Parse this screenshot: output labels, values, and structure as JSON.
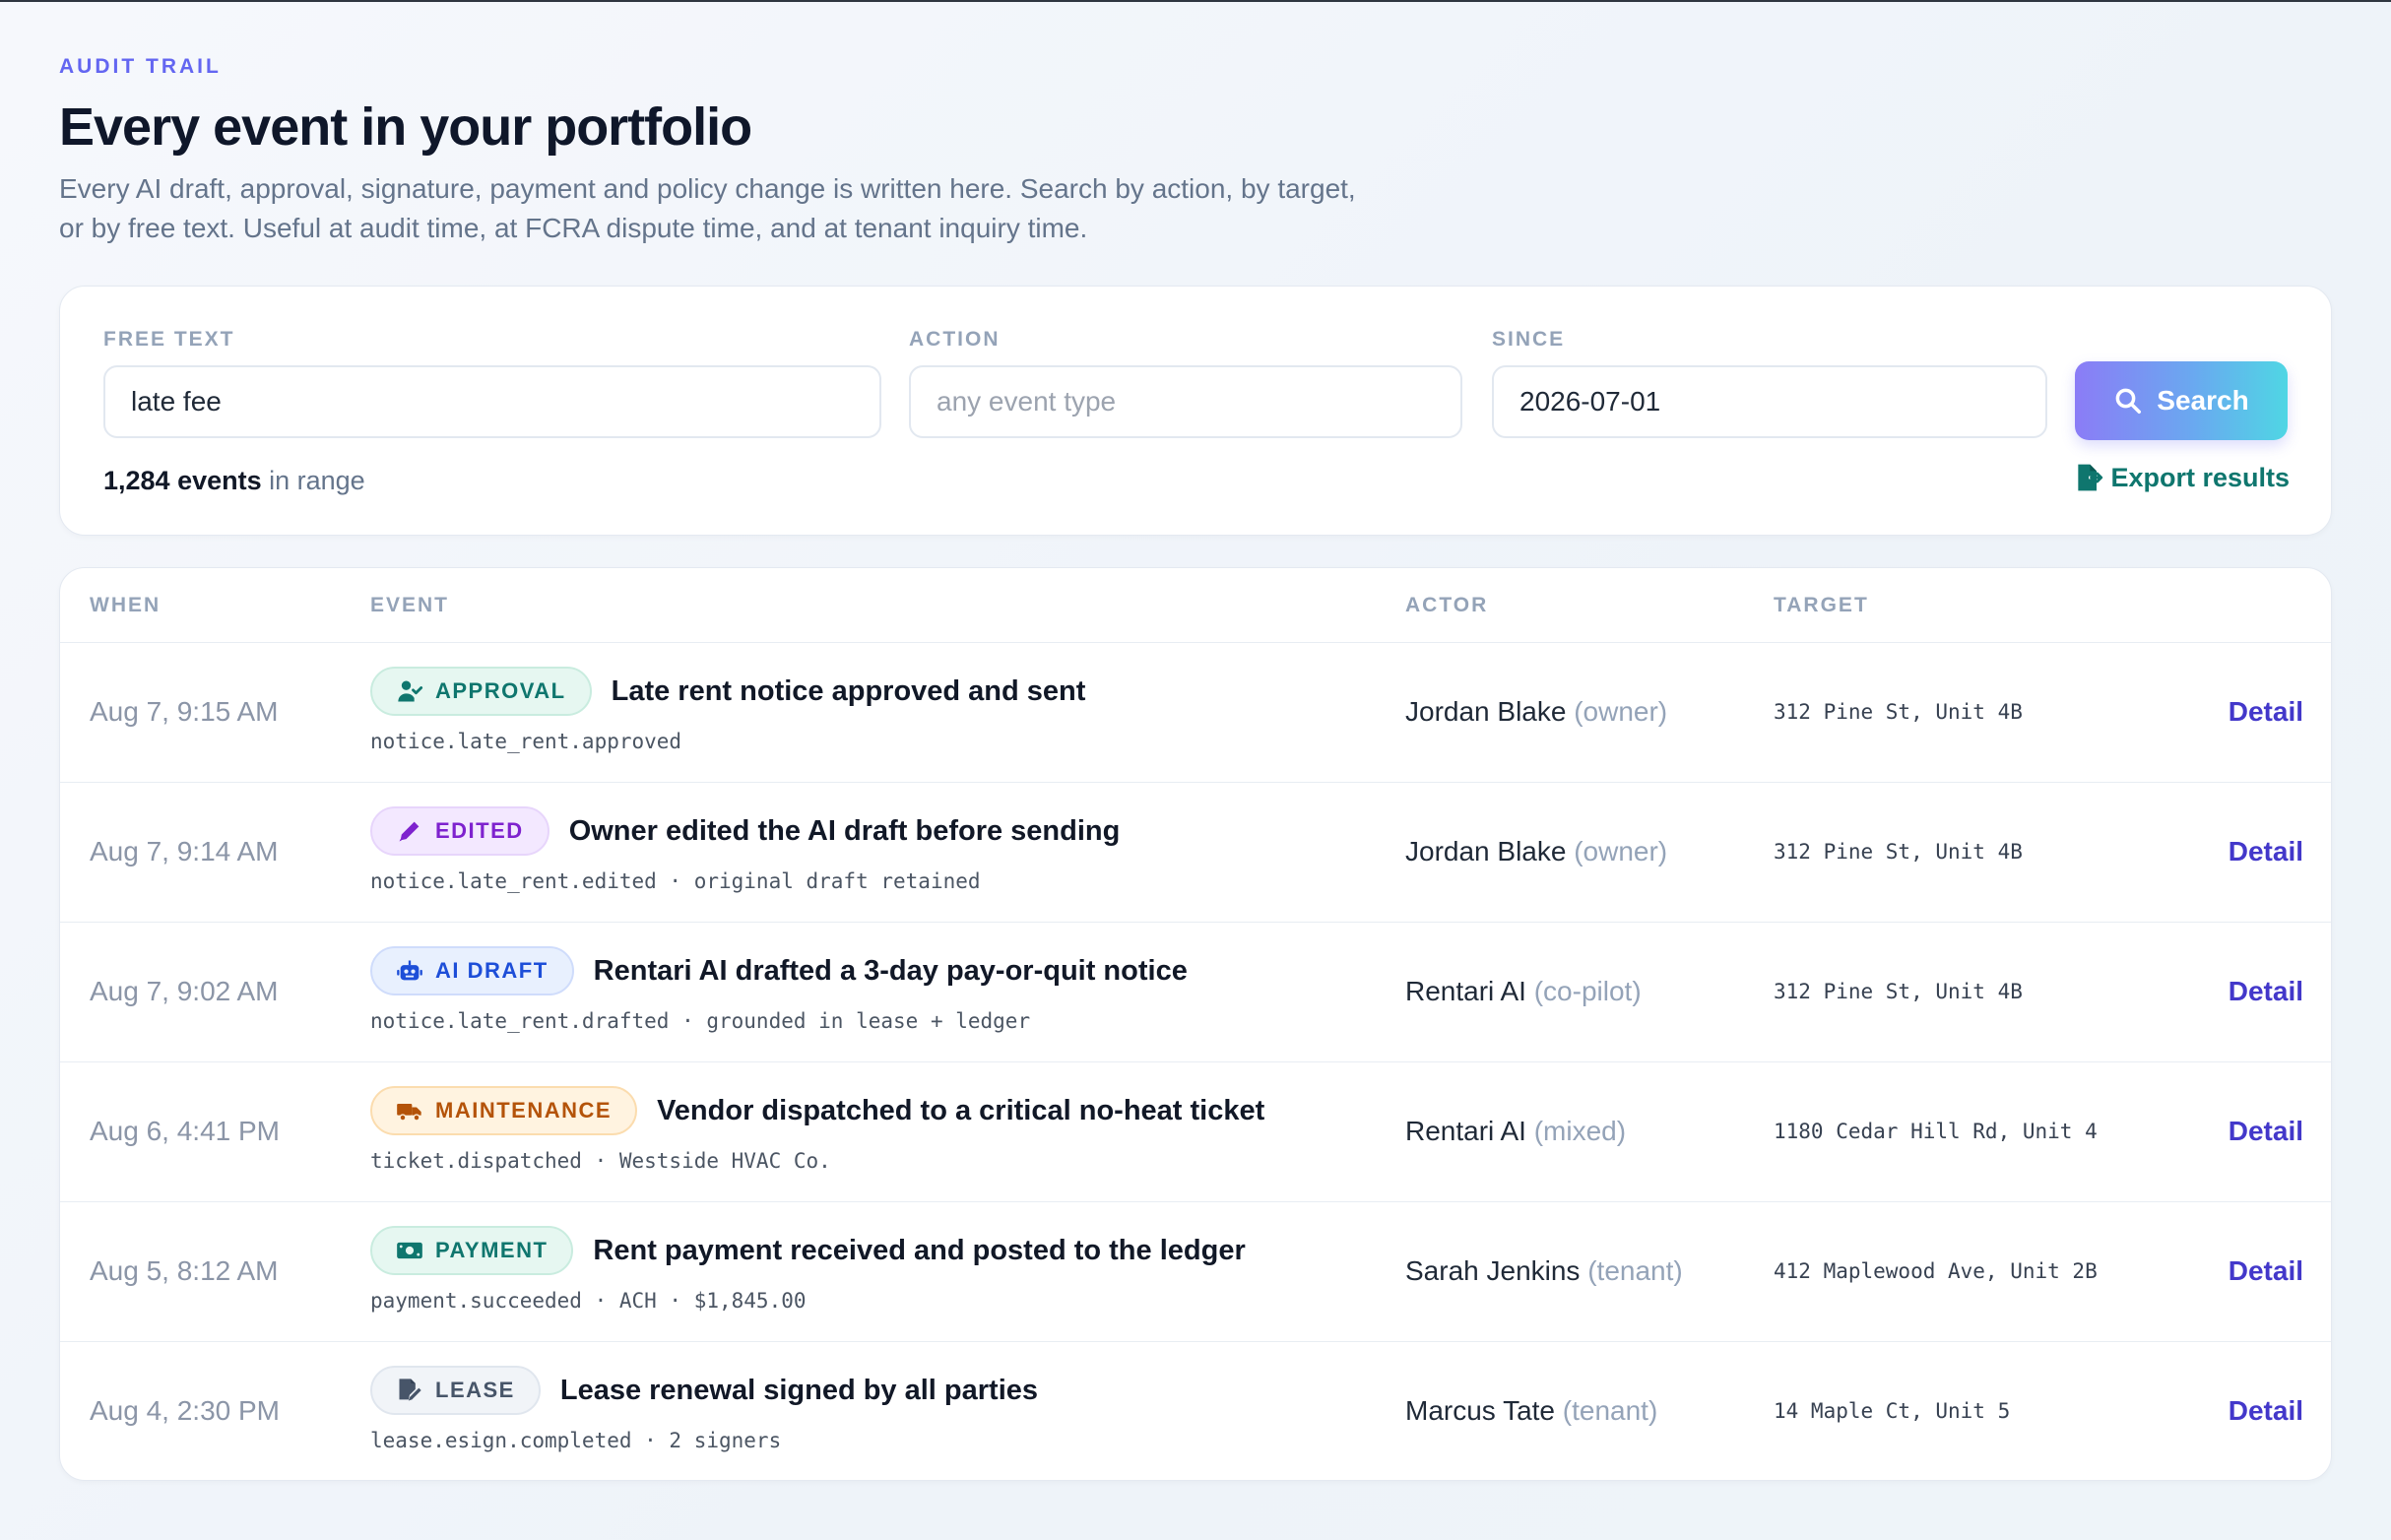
{
  "header": {
    "eyebrow": "AUDIT TRAIL",
    "title": "Every event in your portfolio",
    "subtitle": "Every AI draft, approval, signature, payment and policy change is written here. Search by action, by target, or by free text. Useful at audit time, at FCRA dispute time, and at tenant inquiry time."
  },
  "filters": {
    "free_text": {
      "label": "FREE TEXT",
      "value": "late fee"
    },
    "action": {
      "label": "ACTION",
      "placeholder": "any event type"
    },
    "since": {
      "label": "SINCE",
      "value": "2026-07-01"
    },
    "search_label": "Search",
    "events_count": "1,284 events",
    "events_suffix": " in range",
    "export_label": "Export results"
  },
  "table": {
    "columns": {
      "when": "WHEN",
      "event": "EVENT",
      "actor": "ACTOR",
      "target": "TARGET"
    },
    "detail_label": "Detail",
    "rows": [
      {
        "when": "Aug 7, 9:15 AM",
        "badge": "APPROVAL",
        "badge_icon": "user-check-icon",
        "title": "Late rent notice approved and sent",
        "code": "notice.late_rent.approved",
        "actor": "Jordan Blake",
        "role": "(owner)",
        "target": "312 Pine St, Unit 4B"
      },
      {
        "when": "Aug 7, 9:14 AM",
        "badge": "EDITED",
        "badge_icon": "pencil-icon",
        "title": "Owner edited the AI draft before sending",
        "code": "notice.late_rent.edited · original draft retained",
        "actor": "Jordan Blake",
        "role": "(owner)",
        "target": "312 Pine St, Unit 4B"
      },
      {
        "when": "Aug 7, 9:02 AM",
        "badge": "AI DRAFT",
        "badge_icon": "robot-icon",
        "title": "Rentari AI drafted a 3-day pay-or-quit notice",
        "code": "notice.late_rent.drafted · grounded in lease + ledger",
        "actor": "Rentari AI",
        "role": "(co-pilot)",
        "target": "312 Pine St, Unit 4B"
      },
      {
        "when": "Aug 6, 4:41 PM",
        "badge": "MAINTENANCE",
        "badge_icon": "truck-icon",
        "title": "Vendor dispatched to a critical no-heat ticket",
        "code": "ticket.dispatched · Westside HVAC Co.",
        "actor": "Rentari AI",
        "role": "(mixed)",
        "target": "1180 Cedar Hill Rd, Unit 4"
      },
      {
        "when": "Aug 5, 8:12 AM",
        "badge": "PAYMENT",
        "badge_icon": "money-icon",
        "title": "Rent payment received and posted to the ledger",
        "code": "payment.succeeded · ACH · $1,845.00",
        "actor": "Sarah Jenkins",
        "role": "(tenant)",
        "target": "412 Maplewood Ave, Unit 2B"
      },
      {
        "when": "Aug 4, 2:30 PM",
        "badge": "LEASE",
        "badge_icon": "file-signature-icon",
        "title": "Lease renewal signed by all parties",
        "code": "lease.esign.completed · 2 signers",
        "actor": "Marcus Tate",
        "role": "(tenant)",
        "target": "14 Maple Ct, Unit 5"
      }
    ]
  },
  "colors": {
    "accent": "#6366f1",
    "export": "#0f766e",
    "detail_link": "#4338ca"
  }
}
